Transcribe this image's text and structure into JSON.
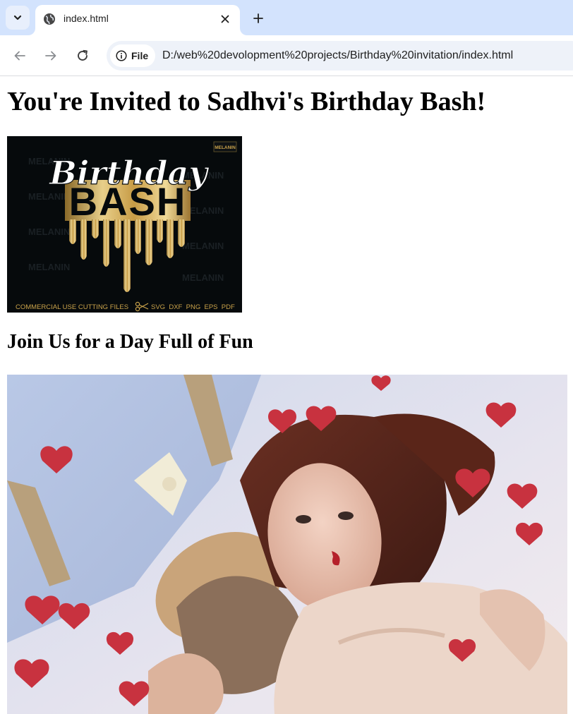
{
  "browser": {
    "tab_title": "index.html",
    "site_chip_label": "File",
    "url": "D:/web%20devolopment%20projects/Birthday%20invitation/index.html",
    "icons": [
      "tab-search-icon",
      "globe-icon",
      "close-icon",
      "plus-icon",
      "back-arrow-icon",
      "forward-arrow-icon",
      "reload-icon",
      "info-icon"
    ]
  },
  "page": {
    "heading": "You're Invited to Sadhvi's Birthday Bash!",
    "subheading": "Join Us for a Day Full of Fun",
    "banner": {
      "script_text": "Birthday",
      "block_text": "BASH",
      "watermark": "MELANIN",
      "footer_text": "COMMERCIAL USE CUTTING FILES",
      "formats": "SVG  DXF  PNG  EPS  PDF"
    }
  },
  "colors": {
    "tabstrip": "#d3e3fd",
    "omnibox": "#eef2f9",
    "gold": "#c9a24a",
    "heart_red": "#c8323f"
  }
}
